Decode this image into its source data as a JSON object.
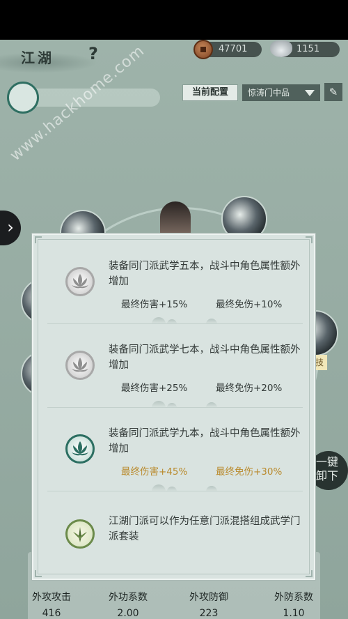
{
  "topbar": {
    "title": "江湖",
    "help": "?",
    "copper": "47701",
    "silver": "1151"
  },
  "config": {
    "label": "当前配置",
    "selected": "惊涛门中品"
  },
  "side": {
    "arrow": "›",
    "one_key": "一键卸下",
    "skill_tag": "技"
  },
  "watermark": "www.hackhome.com",
  "stats": [
    {
      "label": "外攻攻击",
      "value": "416"
    },
    {
      "label": "外功系数",
      "value": "2.00"
    },
    {
      "label": "外攻防御",
      "value": "223"
    },
    {
      "label": "外防系数",
      "value": "1.10"
    }
  ],
  "modal": {
    "tiers": [
      {
        "desc": "装备同门派武学五本，战斗中角色属性额外增加",
        "dmg": "最终伤害+15%",
        "def": "最终免伤+10%",
        "active": false
      },
      {
        "desc": "装备同门派武学七本，战斗中角色属性额外增加",
        "dmg": "最终伤害+25%",
        "def": "最终免伤+20%",
        "active": false
      },
      {
        "desc": "装备同门派武学九本，战斗中角色属性额外增加",
        "dmg": "最终伤害+45%",
        "def": "最终免伤+30%",
        "active": true
      }
    ],
    "note": "江湖门派可以作为任意门派混搭组成武学门派套装"
  },
  "colors": {
    "accent_gold": "#b98a2c",
    "active_green": "#2b6e61",
    "modal_bg": "#d9e3e0"
  }
}
